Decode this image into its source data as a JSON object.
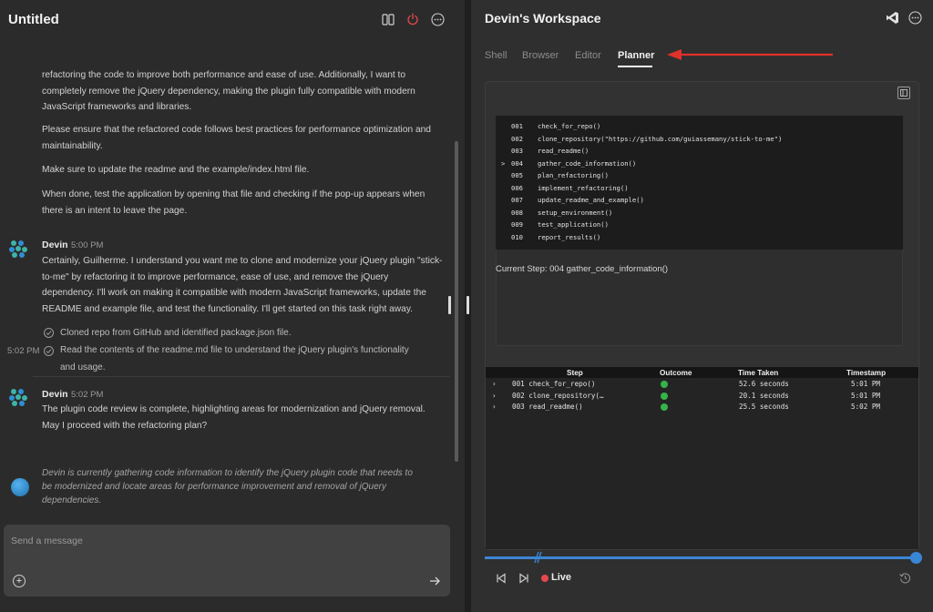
{
  "left": {
    "title": "Untitled",
    "user_message": {
      "p1": "refactoring the code to improve both performance and ease of use. Additionally, I want to completely remove the jQuery dependency, making the plugin fully compatible with modern JavaScript frameworks and libraries.",
      "p2": "Please ensure that the refactored code follows best practices for performance optimization and maintainability.",
      "p3": "Make sure to update the readme and the example/index.html file.",
      "p4": "When done, test the application by opening that file and checking if the pop-up appears when there is an intent to leave the page."
    },
    "msg1": {
      "name": "Devin",
      "time": "5:00 PM",
      "text": "Certainly, Guilherme. I understand you want me to clone and modernize your jQuery plugin \"stick-to-me\" by refactoring it to improve performance, ease of use, and remove the jQuery dependency. I'll work on making it compatible with modern JavaScript frameworks, update the README and example file, and test the functionality. I'll get started on this task right away."
    },
    "log": {
      "item1": "Cloned repo from GitHub and identified package.json file.",
      "item2": "Read the contents of the readme.md file to understand the jQuery plugin's functionality and usage.",
      "time": "5:02 PM"
    },
    "msg2": {
      "name": "Devin",
      "time": "5:02 PM",
      "text": "The plugin code review is complete, highlighting areas for modernization and jQuery removal. May I proceed with the refactoring plan?"
    },
    "status": "Devin is currently gathering code information to identify the jQuery plugin code that needs to be modernized and locate areas for performance improvement and removal of jQuery dependencies.",
    "composer": {
      "placeholder": "Send a message"
    }
  },
  "right": {
    "title": "Devin's Workspace",
    "tabs": [
      "Shell",
      "Browser",
      "Editor",
      "Planner"
    ],
    "active_tab": "Planner",
    "plan": [
      {
        "num": "001",
        "fn": "check_for_repo()",
        "marker": ""
      },
      {
        "num": "002",
        "fn": "clone_repository(\"https://github.com/guiassemany/stick-to-me\")",
        "marker": ""
      },
      {
        "num": "003",
        "fn": "read_readme()",
        "marker": ""
      },
      {
        "num": "004",
        "fn": "gather_code_information()",
        "marker": ">"
      },
      {
        "num": "005",
        "fn": "plan_refactoring()",
        "marker": ""
      },
      {
        "num": "006",
        "fn": "implement_refactoring()",
        "marker": ""
      },
      {
        "num": "007",
        "fn": "update_readme_and_example()",
        "marker": ""
      },
      {
        "num": "008",
        "fn": "setup_environment()",
        "marker": ""
      },
      {
        "num": "009",
        "fn": "test_application()",
        "marker": ""
      },
      {
        "num": "010",
        "fn": "report_results()",
        "marker": ""
      }
    ],
    "current_step": "Current Step: 004 gather_code_information()",
    "table": {
      "headers": [
        "Step",
        "Outcome",
        "Time Taken",
        "Timestamp"
      ],
      "rows": [
        {
          "step": "001 check_for_repo()",
          "outcome": "success",
          "time": "52.6 seconds",
          "stamp": "5:01 PM"
        },
        {
          "step": "002 clone_repository(…",
          "outcome": "success",
          "time": "20.1 seconds",
          "stamp": "5:01 PM"
        },
        {
          "step": "003 read_readme()",
          "outcome": "success",
          "time": "25.5 seconds",
          "stamp": "5:02 PM"
        }
      ]
    },
    "live_label": "Live"
  },
  "colors": {
    "accent_blue": "#3a86d6",
    "success_green": "#36b34a",
    "live_red": "#e5484d",
    "annotation_red": "#e0312b"
  }
}
